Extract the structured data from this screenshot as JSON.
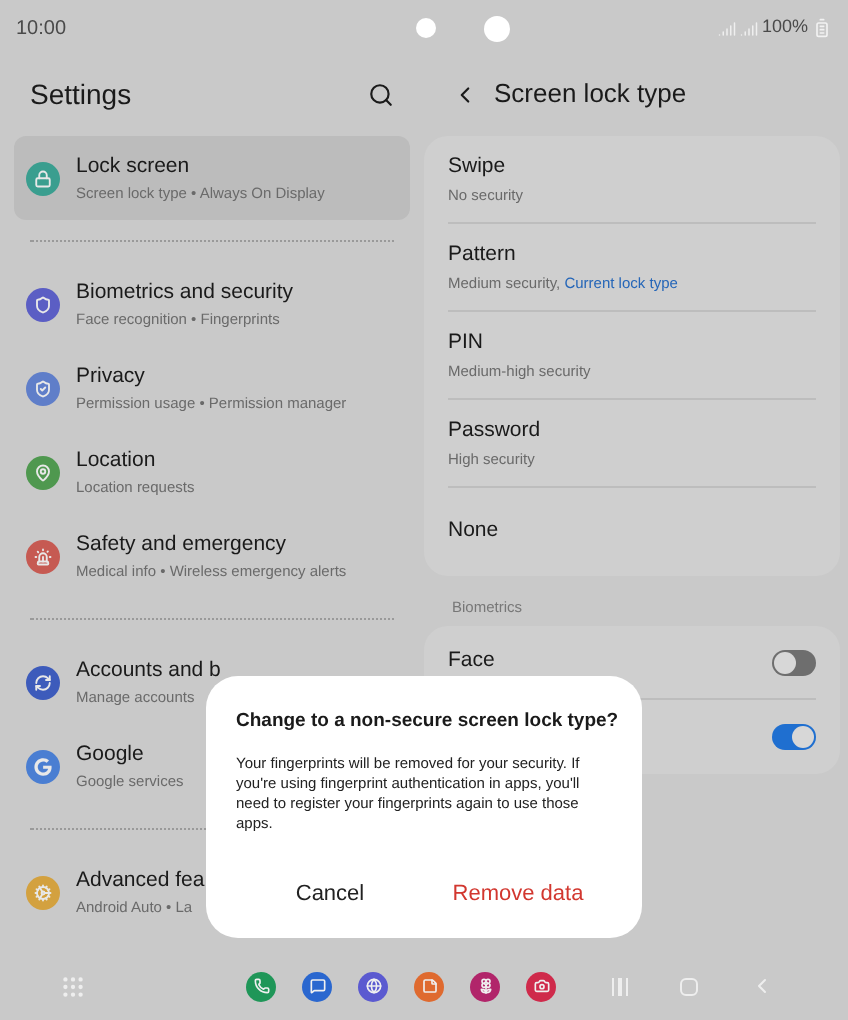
{
  "status_bar": {
    "time": "10:00",
    "battery": "100%"
  },
  "settings": {
    "title": "Settings",
    "groups": [
      [
        {
          "title": "Lock screen",
          "subtitle": "Screen lock type  •  Always On Display",
          "selected": true
        }
      ],
      [
        {
          "title": "Biometrics and security",
          "subtitle": "Face recognition  •  Fingerprints",
          "selected": false
        },
        {
          "title": "Privacy",
          "subtitle": "Permission usage  •  Permission manager",
          "selected": false
        },
        {
          "title": "Location",
          "subtitle": "Location requests",
          "selected": false
        },
        {
          "title": "Safety and emergency",
          "subtitle": "Medical info  •  Wireless emergency alerts",
          "selected": false
        }
      ],
      [
        {
          "title": "Accounts and b",
          "subtitle": "Manage accounts",
          "selected": false
        },
        {
          "title": "Google",
          "subtitle": "Google services",
          "selected": false
        }
      ],
      [
        {
          "title": "Advanced fea",
          "subtitle": "Android Auto  •  La",
          "selected": false
        }
      ]
    ]
  },
  "screen_lock": {
    "title": "Screen lock type",
    "options": [
      {
        "title": "Swipe",
        "subtitle": "No security"
      },
      {
        "title": "Pattern",
        "subtitle": "Medium security, ",
        "note": "Current lock type"
      },
      {
        "title": "PIN",
        "subtitle": "Medium-high security"
      },
      {
        "title": "Password",
        "subtitle": "High security"
      },
      {
        "title": "None"
      }
    ],
    "biometrics_label": "Biometrics",
    "biometrics": [
      {
        "label": "Face",
        "on": false
      },
      {
        "on": true
      }
    ]
  },
  "dialog": {
    "title": "Change to a non-secure screen lock type?",
    "message": "Your fingerprints will be removed for your security. If you're using fingerprint authentication in apps, you'll need to register your fingerprints again to use those apps.",
    "buttons": [
      "Cancel",
      "Remove data"
    ]
  }
}
